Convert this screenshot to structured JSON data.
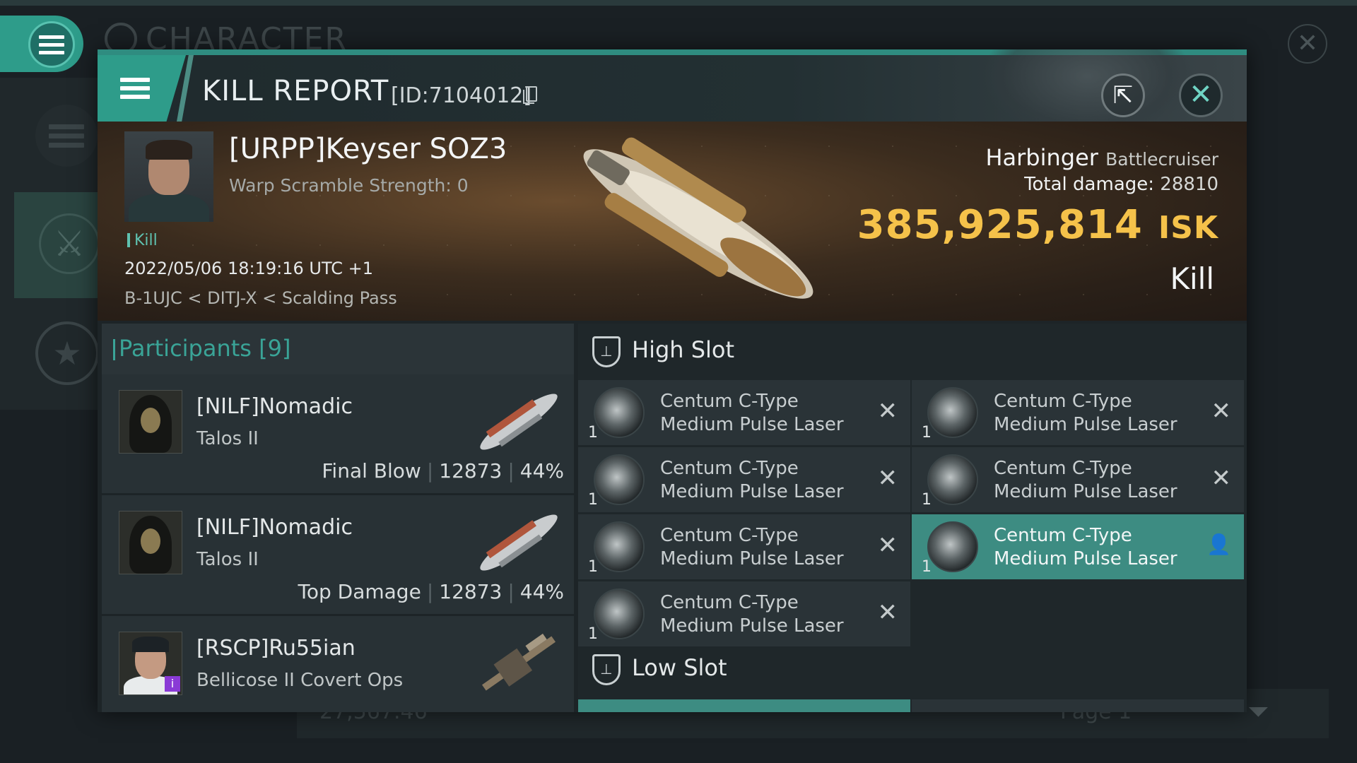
{
  "background": {
    "window_title": "CHARACTER",
    "bottom_value": "27,567.46",
    "bottom_page": "Page 1"
  },
  "dialog": {
    "title": "KILL REPORT",
    "id_label": "[ID:7104012]"
  },
  "victim": {
    "name": "[URPP]Keyser SOZ3",
    "warp_scramble": "Warp Scramble Strength: 0",
    "tag": "Kill",
    "datetime": "2022/05/06 18:19:16 UTC +1",
    "location": "B-1UJC < DITJ-X < Scalding Pass",
    "ship_name": "Harbinger",
    "ship_class": "Battlecruiser",
    "total_damage_label": "Total damage:",
    "total_damage": "28810",
    "isk_value": "385,925,814",
    "isk_unit": "ISK",
    "result": "Kill"
  },
  "participants": {
    "title": "Participants [9]",
    "rows": [
      {
        "name": "[NILF]Nomadic",
        "ship": "Talos II",
        "role": "Final Blow",
        "damage": "12873",
        "percent": "44%"
      },
      {
        "name": "[NILF]Nomadic",
        "ship": "Talos II",
        "role": "Top Damage",
        "damage": "12873",
        "percent": "44%"
      },
      {
        "name": "[RSCP]Ru55ian",
        "ship": "Bellicose II Covert Ops",
        "role": "",
        "damage": "",
        "percent": ""
      }
    ]
  },
  "slots": {
    "high": {
      "label": "High Slot",
      "items": [
        {
          "qty": "1",
          "line1": "Centum C-Type",
          "line2": "Medium Pulse Laser",
          "status": "destroyed"
        },
        {
          "qty": "1",
          "line1": "Centum C-Type",
          "line2": "Medium Pulse Laser",
          "status": "destroyed"
        },
        {
          "qty": "1",
          "line1": "Centum C-Type",
          "line2": "Medium Pulse Laser",
          "status": "destroyed"
        },
        {
          "qty": "1",
          "line1": "Centum C-Type",
          "line2": "Medium Pulse Laser",
          "status": "destroyed"
        },
        {
          "qty": "1",
          "line1": "Centum C-Type",
          "line2": "Medium Pulse Laser",
          "status": "destroyed"
        },
        {
          "qty": "1",
          "line1": "Centum C-Type",
          "line2": "Medium Pulse Laser",
          "status": "dropped"
        },
        {
          "qty": "1",
          "line1": "Centum C-Type",
          "line2": "Medium Pulse Laser",
          "status": "destroyed"
        }
      ]
    },
    "low": {
      "label": "Low Slot"
    }
  },
  "colors": {
    "accent": "#2e9c8a",
    "isk": "#f5c24a",
    "highlight": "#3d8c82"
  },
  "icons": {
    "menu": "hamburger-icon",
    "share": "share-icon",
    "close": "close-icon",
    "copy": "copy-icon",
    "slot": "slot-shield-icon",
    "destroyed": "x-icon",
    "dropped": "person-icon"
  }
}
